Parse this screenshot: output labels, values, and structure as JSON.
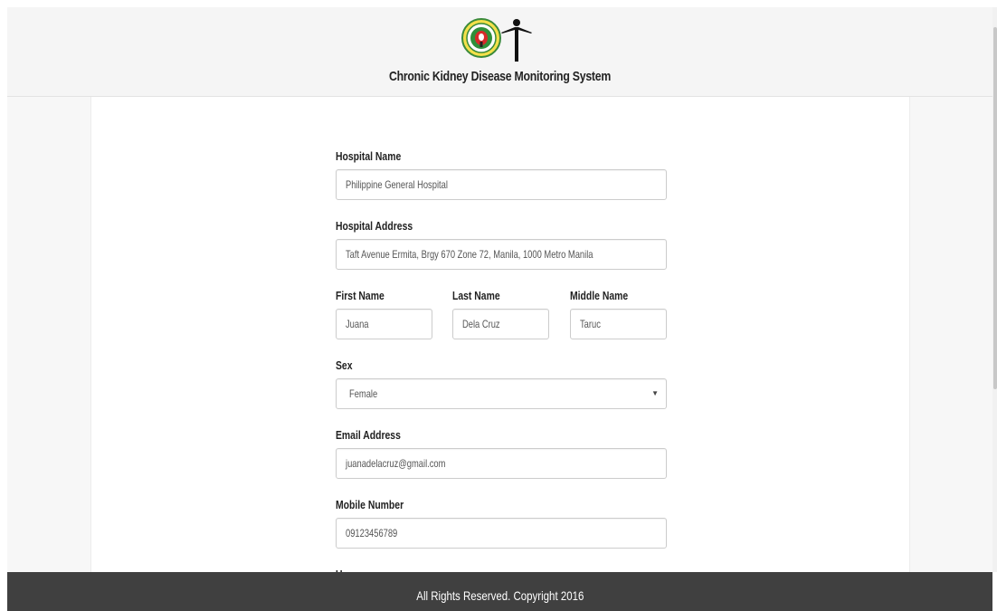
{
  "header": {
    "title": "Chronic Kidney Disease Monitoring System"
  },
  "form": {
    "hospital_name": {
      "label": "Hospital Name",
      "value": "Philippine General Hospital"
    },
    "hospital_address": {
      "label": "Hospital Address",
      "value": "Taft Avenue Ermita, Brgy 670 Zone 72, Manila, 1000 Metro Manila"
    },
    "first_name": {
      "label": "First Name",
      "value": "Juana"
    },
    "last_name": {
      "label": "Last Name",
      "value": "Dela Cruz"
    },
    "middle_name": {
      "label": "Middle Name",
      "value": "Taruc"
    },
    "sex": {
      "label": "Sex",
      "value": "Female",
      "arrow": "▼"
    },
    "email": {
      "label": "Email Address",
      "value": "juanadelacruz@gmail.com"
    },
    "mobile": {
      "label": "Mobile Number",
      "value": "09123456789"
    },
    "username": {
      "label": "Username"
    }
  },
  "footer": {
    "text": "All Rights Reserved. Copyright 2016"
  }
}
